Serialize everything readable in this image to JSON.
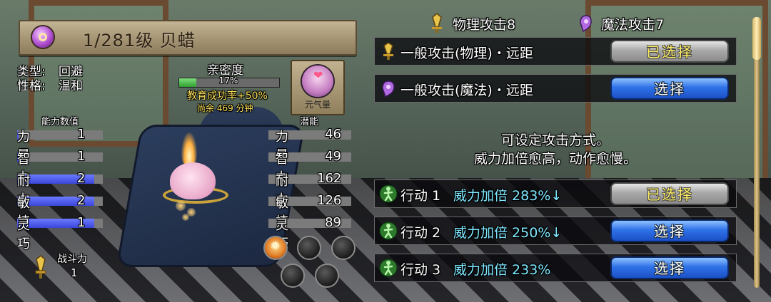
{
  "pet": {
    "title": "1/281级 贝蜡",
    "type_label": "类型:",
    "type_value": "回避",
    "personality_label": "性格:",
    "personality_value": "温和",
    "intimacy_label": "亲密度",
    "intimacy_percent_text": "17%",
    "intimacy_fill": 0.17,
    "education_rate": "教育成功率+50%",
    "time_left": "尚余 469 分钟",
    "item_label": "元气量",
    "ability_header": "能力数值",
    "potential_header": "潜能",
    "abilities": [
      {
        "name": "力量",
        "value": "1",
        "fill": 0.02
      },
      {
        "name": "智力",
        "value": "1",
        "fill": 0.02
      },
      {
        "name": "耐力",
        "value": "2",
        "fill": 0.9
      },
      {
        "name": "敏捷",
        "value": "2",
        "fill": 0.9
      },
      {
        "name": "灵巧",
        "value": "1",
        "fill": 0.9
      }
    ],
    "potentials": [
      {
        "name": "力量",
        "value": "46",
        "fill": 0.0
      },
      {
        "name": "智力",
        "value": "49",
        "fill": 0.0
      },
      {
        "name": "耐力",
        "value": "162",
        "fill": 0.0
      },
      {
        "name": "敏捷",
        "value": "126",
        "fill": 0.0
      },
      {
        "name": "灵巧",
        "value": "89",
        "fill": 0.0
      }
    ],
    "combat_power_label": "战斗力",
    "combat_power_value": "1"
  },
  "attack": {
    "physical_header": "物理攻击8",
    "magic_header": "魔法攻击7",
    "modes": [
      {
        "label": "一般攻击(物理)・远距",
        "button": "已选择",
        "state": "selected",
        "icon": "physical-sword-icon"
      },
      {
        "label": "一般攻击(魔法)・远距",
        "button": "选择",
        "state": "available",
        "icon": "magic-hand-icon"
      }
    ],
    "help_line1": "可设定攻击方式。",
    "help_line2": "威力加倍愈高，动作愈慢。",
    "actions": [
      {
        "label": "行动 1",
        "power": "威力加倍 283%↓",
        "button": "已选择",
        "state": "selected"
      },
      {
        "label": "行动 2",
        "power": "威力加倍 250%↓",
        "button": "选择",
        "state": "available"
      },
      {
        "label": "行动 3",
        "power": "威力加倍 233%",
        "button": "选择",
        "state": "available"
      }
    ]
  },
  "colors": {
    "selected_text": "#ffee66",
    "power_text": "#7ee7ff",
    "select_blue": "#2f72e8"
  }
}
